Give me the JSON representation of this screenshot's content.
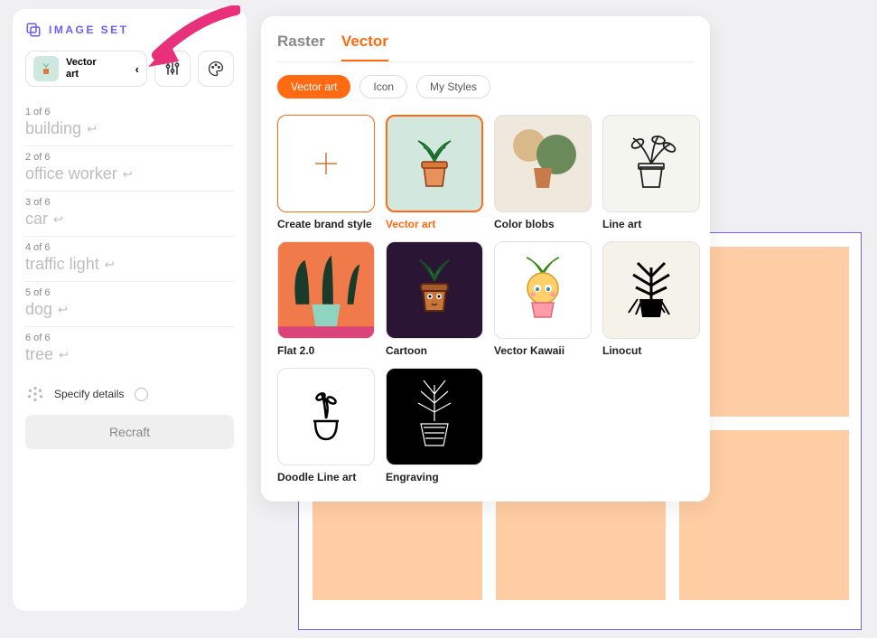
{
  "sidebar": {
    "title": "IMAGE SET",
    "style_chip": {
      "line1": "Vector",
      "line2": "art"
    },
    "prompts": [
      {
        "counter": "1 of 6",
        "value": "building"
      },
      {
        "counter": "2 of 6",
        "value": "office worker"
      },
      {
        "counter": "3 of 6",
        "value": "car"
      },
      {
        "counter": "4 of 6",
        "value": "traffic light"
      },
      {
        "counter": "5 of 6",
        "value": "dog"
      },
      {
        "counter": "6 of 6",
        "value": "tree"
      }
    ],
    "specify_label": "Specify details",
    "recraft_label": "Recraft"
  },
  "popover": {
    "tabs": {
      "raster": "Raster",
      "vector": "Vector"
    },
    "pills": {
      "vector_art": "Vector art",
      "icon": "Icon",
      "my_styles": "My Styles"
    },
    "styles": [
      {
        "label": "Create brand style"
      },
      {
        "label": "Vector art"
      },
      {
        "label": "Color blobs"
      },
      {
        "label": "Line art"
      },
      {
        "label": "Flat 2.0"
      },
      {
        "label": "Cartoon"
      },
      {
        "label": "Vector Kawaii"
      },
      {
        "label": "Linocut"
      },
      {
        "label": "Doodle Line art"
      },
      {
        "label": "Engraving"
      }
    ]
  },
  "colors": {
    "accent": "#ff6a13",
    "brand": "#6b5cff",
    "canvas_tile": "#ffcda3"
  }
}
